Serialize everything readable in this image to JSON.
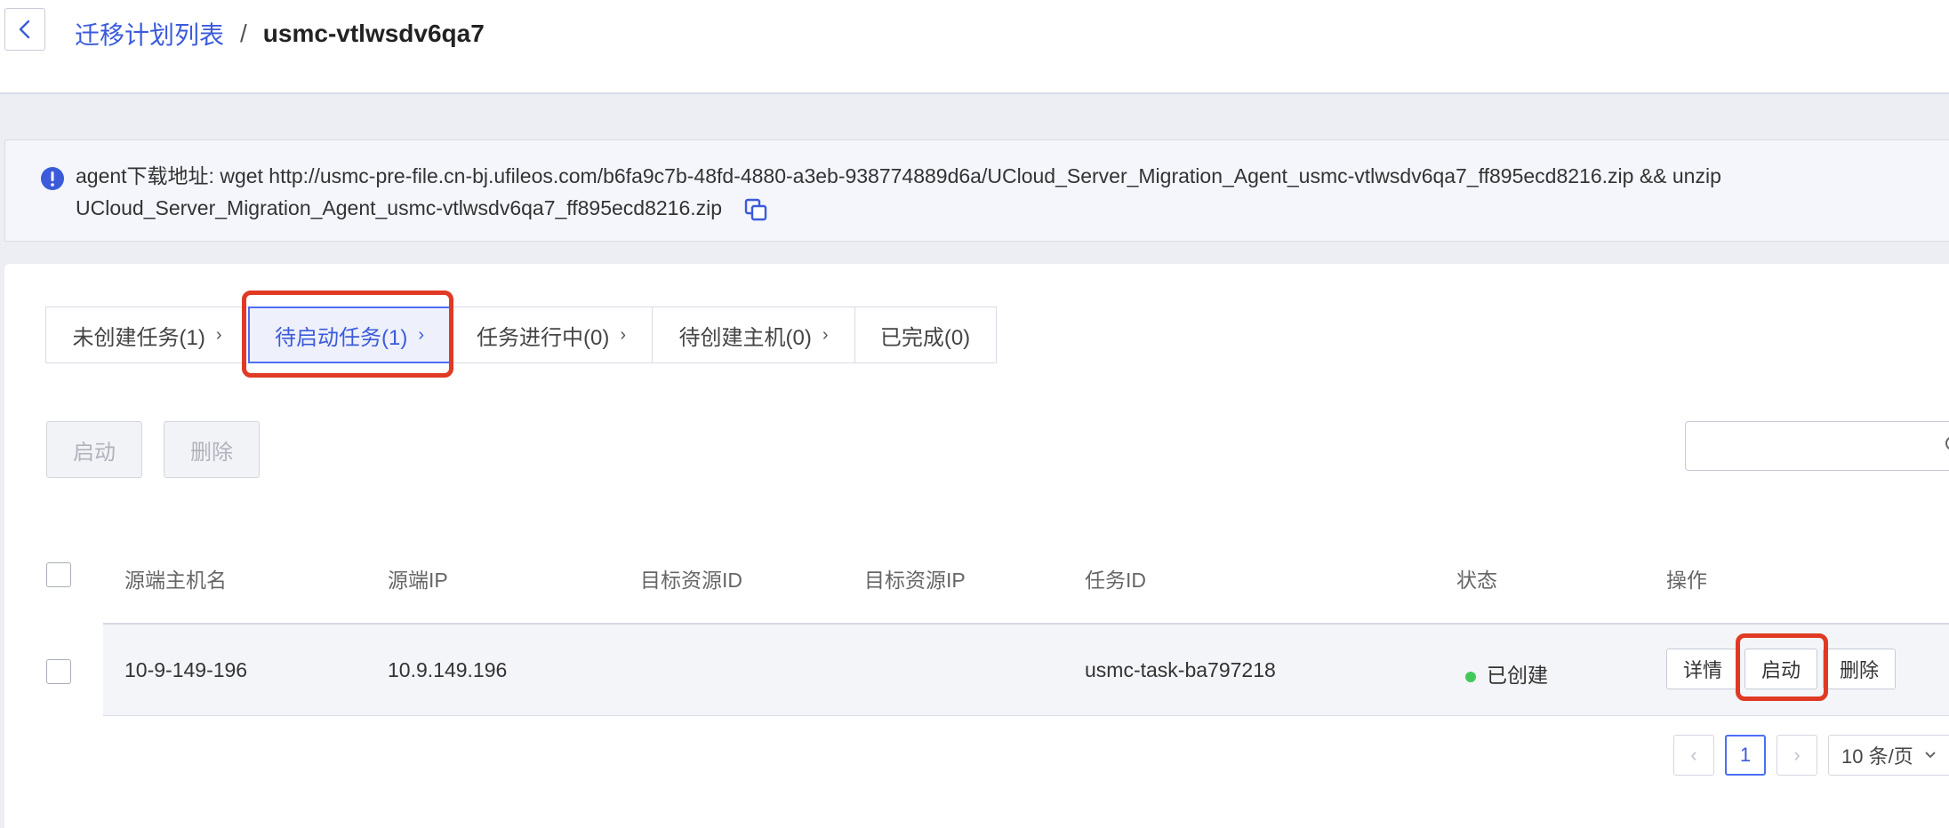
{
  "breadcrumb": {
    "parent": "迁移计划列表",
    "separator": "/",
    "current": "usmc-vtlwsdv6qa7"
  },
  "notice": {
    "line1": "agent下载地址: wget http://usmc-pre-file.cn-bj.ufileos.com/b6fa9c7b-48fd-4880-a3eb-938774889d6a/UCloud_Server_Migration_Agent_usmc-vtlwsdv6qa7_ff895ecd8216.zip && unzip",
    "line2": "UCloud_Server_Migration_Agent_usmc-vtlwsdv6qa7_ff895ecd8216.zip"
  },
  "tabs": [
    {
      "label": "未创建任务(1)",
      "active": false
    },
    {
      "label": "待启动任务(1)",
      "active": true
    },
    {
      "label": "任务进行中(0)",
      "active": false
    },
    {
      "label": "待创建主机(0)",
      "active": false
    },
    {
      "label": "已完成(0)",
      "active": false
    }
  ],
  "toolbar": {
    "start_label": "启动",
    "delete_label": "删除"
  },
  "search": {
    "placeholder": ""
  },
  "table": {
    "columns": [
      "源端主机名",
      "源端IP",
      "目标资源ID",
      "目标资源IP",
      "任务ID",
      "状态",
      "操作"
    ],
    "rows": [
      {
        "hostname": "10-9-149-196",
        "source_ip": "10.9.149.196",
        "target_resource_id": "",
        "target_resource_ip": "",
        "task_id": "usmc-task-ba797218",
        "status": "已创建",
        "actions": {
          "detail": "详情",
          "start": "启动",
          "delete": "删除"
        }
      }
    ]
  },
  "pagination": {
    "prev": "‹",
    "current_page": "1",
    "next": "›",
    "page_size": "10 条/页"
  },
  "colors": {
    "accent": "#3b5bdb",
    "highlight": "#e03a24",
    "status_created": "#43c95a"
  }
}
